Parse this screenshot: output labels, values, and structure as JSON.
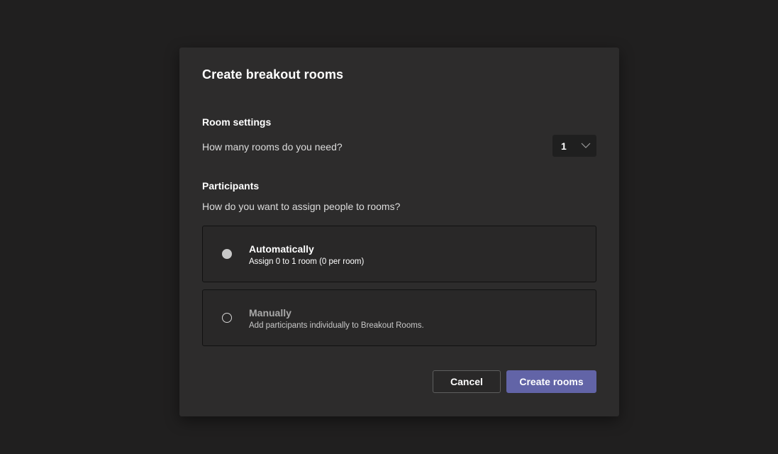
{
  "dialog": {
    "title": "Create breakout rooms"
  },
  "room_settings": {
    "heading": "Room settings",
    "question": "How many rooms do you need?",
    "room_count": "1",
    "dropdown_icon": "chevron-down-icon"
  },
  "participants": {
    "heading": "Participants",
    "question": "How do you want to assign people to rooms?",
    "options": [
      {
        "title": "Automatically",
        "description": "Assign 0 to 1 room (0 per room)",
        "selected": true
      },
      {
        "title": "Manually",
        "description": "Add participants individually to Breakout Rooms.",
        "selected": false
      }
    ]
  },
  "actions": {
    "cancel_label": "Cancel",
    "create_label": "Create rooms"
  },
  "colors": {
    "background": "#201f1f",
    "dialog": "#2d2c2c",
    "accent": "#6264a7"
  }
}
